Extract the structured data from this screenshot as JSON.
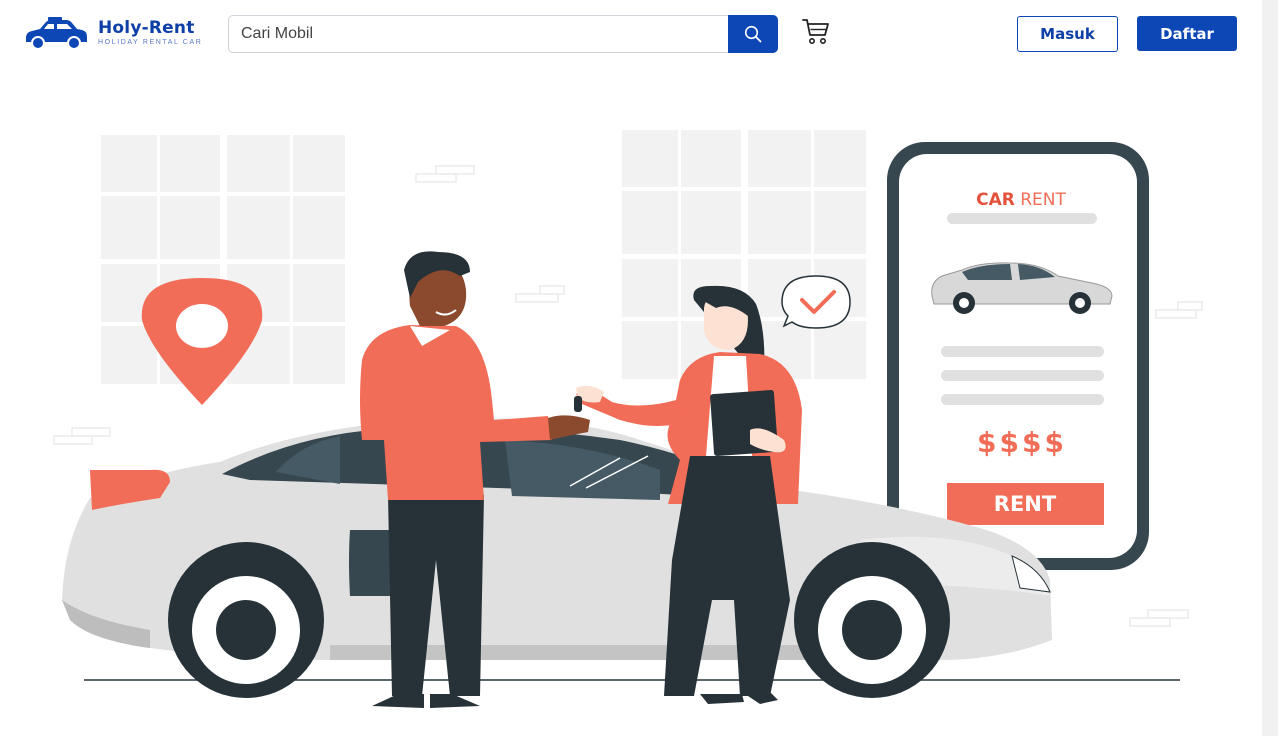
{
  "brand": {
    "name": "Holy-Rent",
    "tagline": "HOLIDAY RENTAL CAR"
  },
  "search": {
    "placeholder": "Cari Mobil",
    "button_icon": "search-icon"
  },
  "cart": {
    "icon": "cart-icon"
  },
  "auth": {
    "login_label": "Masuk",
    "register_label": "Daftar"
  },
  "hero": {
    "phone": {
      "title_strong": "CAR",
      "title_light": " RENT",
      "price": "$$$$",
      "rent_button": "RENT"
    }
  },
  "colors": {
    "primary": "#0d47b5",
    "accent": "#f26d57",
    "dark": "#263238"
  }
}
